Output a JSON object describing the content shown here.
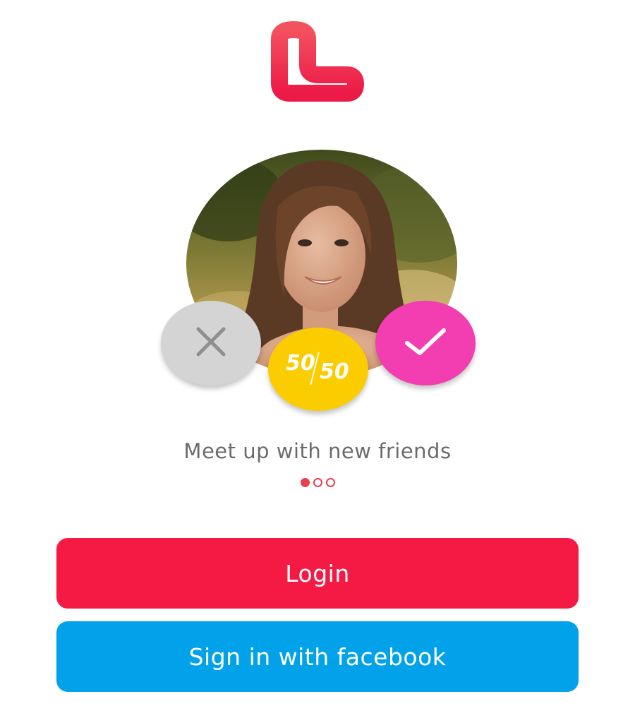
{
  "logo": {
    "icon": "heart-logo-icon",
    "color_top": "#f4515f",
    "color_bottom": "#ec1a47"
  },
  "photo": {
    "icon": "profile-photo-woman"
  },
  "actions": {
    "reject_icon": "close-icon",
    "fifty_left": "50",
    "fifty_right": "50",
    "accept_icon": "check-icon",
    "colors": {
      "reject": "#d4d4d4",
      "fifty": "#fbcc00",
      "accept": "#f23eb0"
    }
  },
  "tagline": "Meet up with new friends",
  "pager": {
    "count": 3,
    "active_index": 0
  },
  "buttons": {
    "login_label": "Login",
    "facebook_label": "Sign in with facebook",
    "login_color": "#f51a44",
    "facebook_color": "#02a2ea"
  }
}
